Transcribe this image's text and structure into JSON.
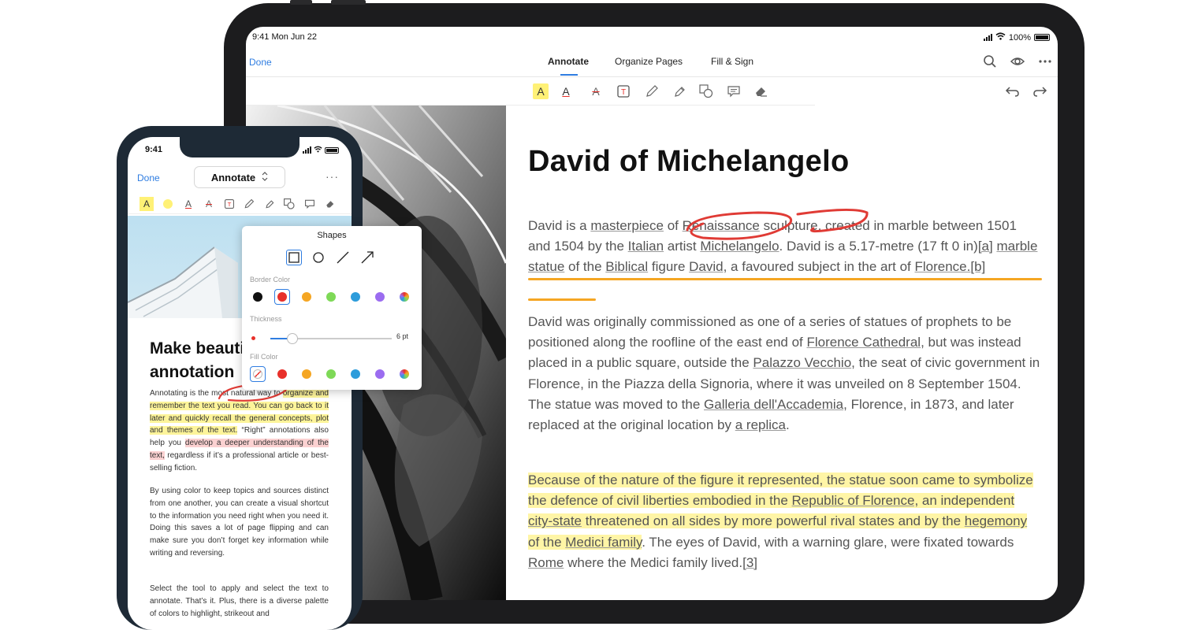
{
  "tablet": {
    "status": {
      "time": "9:41  Mon Jun 22",
      "battery": "100%"
    },
    "nav": {
      "done": "Done",
      "tabs": [
        "Annotate",
        "Organize Pages",
        "Fill & Sign"
      ],
      "active_tab": "Annotate"
    },
    "icons": [
      "search-icon",
      "eye-icon",
      "more-icon",
      "undo-icon",
      "redo-icon"
    ],
    "tools": [
      "highlight-icon",
      "underline-icon",
      "strikeout-icon",
      "text-box-icon",
      "pencil-icon",
      "marker-icon",
      "shapes-icon",
      "comment-icon",
      "eraser-icon"
    ],
    "doc": {
      "title": "David  of Michelangelo",
      "p1": [
        {
          "t": "David is a ",
          "u": false
        },
        {
          "t": "masterpiece",
          "u": true
        },
        {
          "t": " of ",
          "u": false
        },
        {
          "t": "Renaissance",
          "u": true
        },
        {
          "t": " sculpture, created in marble between 1501 and 1504 by the ",
          "u": false
        },
        {
          "t": "Italian",
          "u": true
        },
        {
          "t": " artist ",
          "u": false
        },
        {
          "t": "Michelangelo",
          "u": true
        },
        {
          "t": ". David is a 5.17-metre (17 ft 0 in)",
          "u": false
        },
        {
          "t": "[a]",
          "u": true
        },
        {
          "t": " ",
          "u": false
        },
        {
          "t": "marble statue",
          "u": true
        },
        {
          "t": " of the ",
          "u": false
        },
        {
          "t": "Biblical",
          "u": true
        },
        {
          "t": " figure ",
          "u": false
        },
        {
          "t": "David",
          "u": true
        },
        {
          "t": ", a favoured subject in the art of ",
          "u": false
        },
        {
          "t": "Florence.",
          "u": true
        },
        {
          "t": "[b]",
          "u": true
        }
      ],
      "p2": [
        {
          "t": "David was originally commissioned as one of a series of statues of prophets to be positioned along the roofline of the east end of ",
          "u": false
        },
        {
          "t": "Florence Cathedral",
          "u": true
        },
        {
          "t": ", but was instead placed in a public square, outside the ",
          "u": false
        },
        {
          "t": "Palazzo Vecchio",
          "u": true
        },
        {
          "t": ", the seat of civic government in Florence, in the Piazza della Signoria, where it was unveiled on 8 September 1504. The statue was moved to the ",
          "u": false
        },
        {
          "t": "Galleria dell'Accademia",
          "u": true
        },
        {
          "t": ", Florence, in 1873, and later replaced at the original location by ",
          "u": false
        },
        {
          "t": "a replica",
          "u": true
        },
        {
          "t": ".",
          "u": false
        }
      ],
      "p3": [
        {
          "t": "Because of the nature of the figure it represented, the statue soon came to symbolize the defence of civil liberties embodied in the ",
          "u": false,
          "h": true
        },
        {
          "t": "Republic of Florence",
          "u": true,
          "h": true
        },
        {
          "t": ", an independent ",
          "u": false,
          "h": true
        },
        {
          "t": "city-state",
          "u": true,
          "h": true
        },
        {
          "t": " threatened on all sides by more powerful rival states and by the ",
          "u": false,
          "h": true
        },
        {
          "t": "hegemony",
          "u": true,
          "h": true
        },
        {
          "t": " of the ",
          "u": false,
          "h": true
        },
        {
          "t": "Medici family",
          "u": true,
          "h": true
        },
        {
          "t": ". The eyes of David, with a warning glare, were fixated towards ",
          "u": false,
          "h": false
        },
        {
          "t": "Rome",
          "u": true,
          "h": false
        },
        {
          "t": " where the Medici family lived.",
          "u": false,
          "h": false
        },
        {
          "t": "[3]",
          "u": true,
          "h": false
        }
      ]
    }
  },
  "phone": {
    "time": "9:41",
    "done": "Done",
    "mode": "Annotate",
    "more": "···",
    "heading": "Make beautiful annotation",
    "p1": [
      {
        "t": "Annotating is the most natural way to ",
        "c": ""
      },
      {
        "t": "organize and remember the text you read. You can go back to it later and quickly recall the general concepts, plot and themes of the text.",
        "c": "y"
      },
      {
        "t": " “Right” annotations also help you ",
        "c": ""
      },
      {
        "t": "develop a deeper understanding of the text,",
        "c": "p"
      },
      {
        "t": " regardless if it’s a professional article or best-selling fiction.",
        "c": ""
      }
    ],
    "p2": "By using color to keep topics and sources distinct from one another, you can create a visual shortcut to the information you need right when you need it. Doing this saves a lot of page flipping and can make sure you don’t forget key information while writing and reversing.",
    "p3": "Select the tool to apply and select the text to annotate. That’s it. Plus, there is a diverse palette of colors to highlight, strikeout and",
    "popover": {
      "title": "Shapes",
      "border_label": "Border Color",
      "thickness_label": "Thickness",
      "thickness_value": "6 pt",
      "thickness_level": 0.18,
      "fill_label": "Fill Color",
      "shapes": [
        "square-shape-icon",
        "circle-shape-icon",
        "line-shape-icon",
        "arrow-shape-icon"
      ],
      "border_colors": [
        "#111111",
        "#e8302a",
        "#f5a623",
        "#7ed957",
        "#2d9cdb",
        "#9b6cf0",
        "rainbow"
      ],
      "fill_colors": [
        "none",
        "#e8302a",
        "#f5a623",
        "#7ed957",
        "#2d9cdb",
        "#9b6cf0",
        "rainbow"
      ],
      "selected_border": "#e8302a",
      "selected_fill": "none"
    }
  },
  "colors": {
    "accent": "#2f7de1",
    "highlight": "#fff5a6",
    "underline_orange": "#f5a623",
    "ink_red": "#e03b35"
  }
}
